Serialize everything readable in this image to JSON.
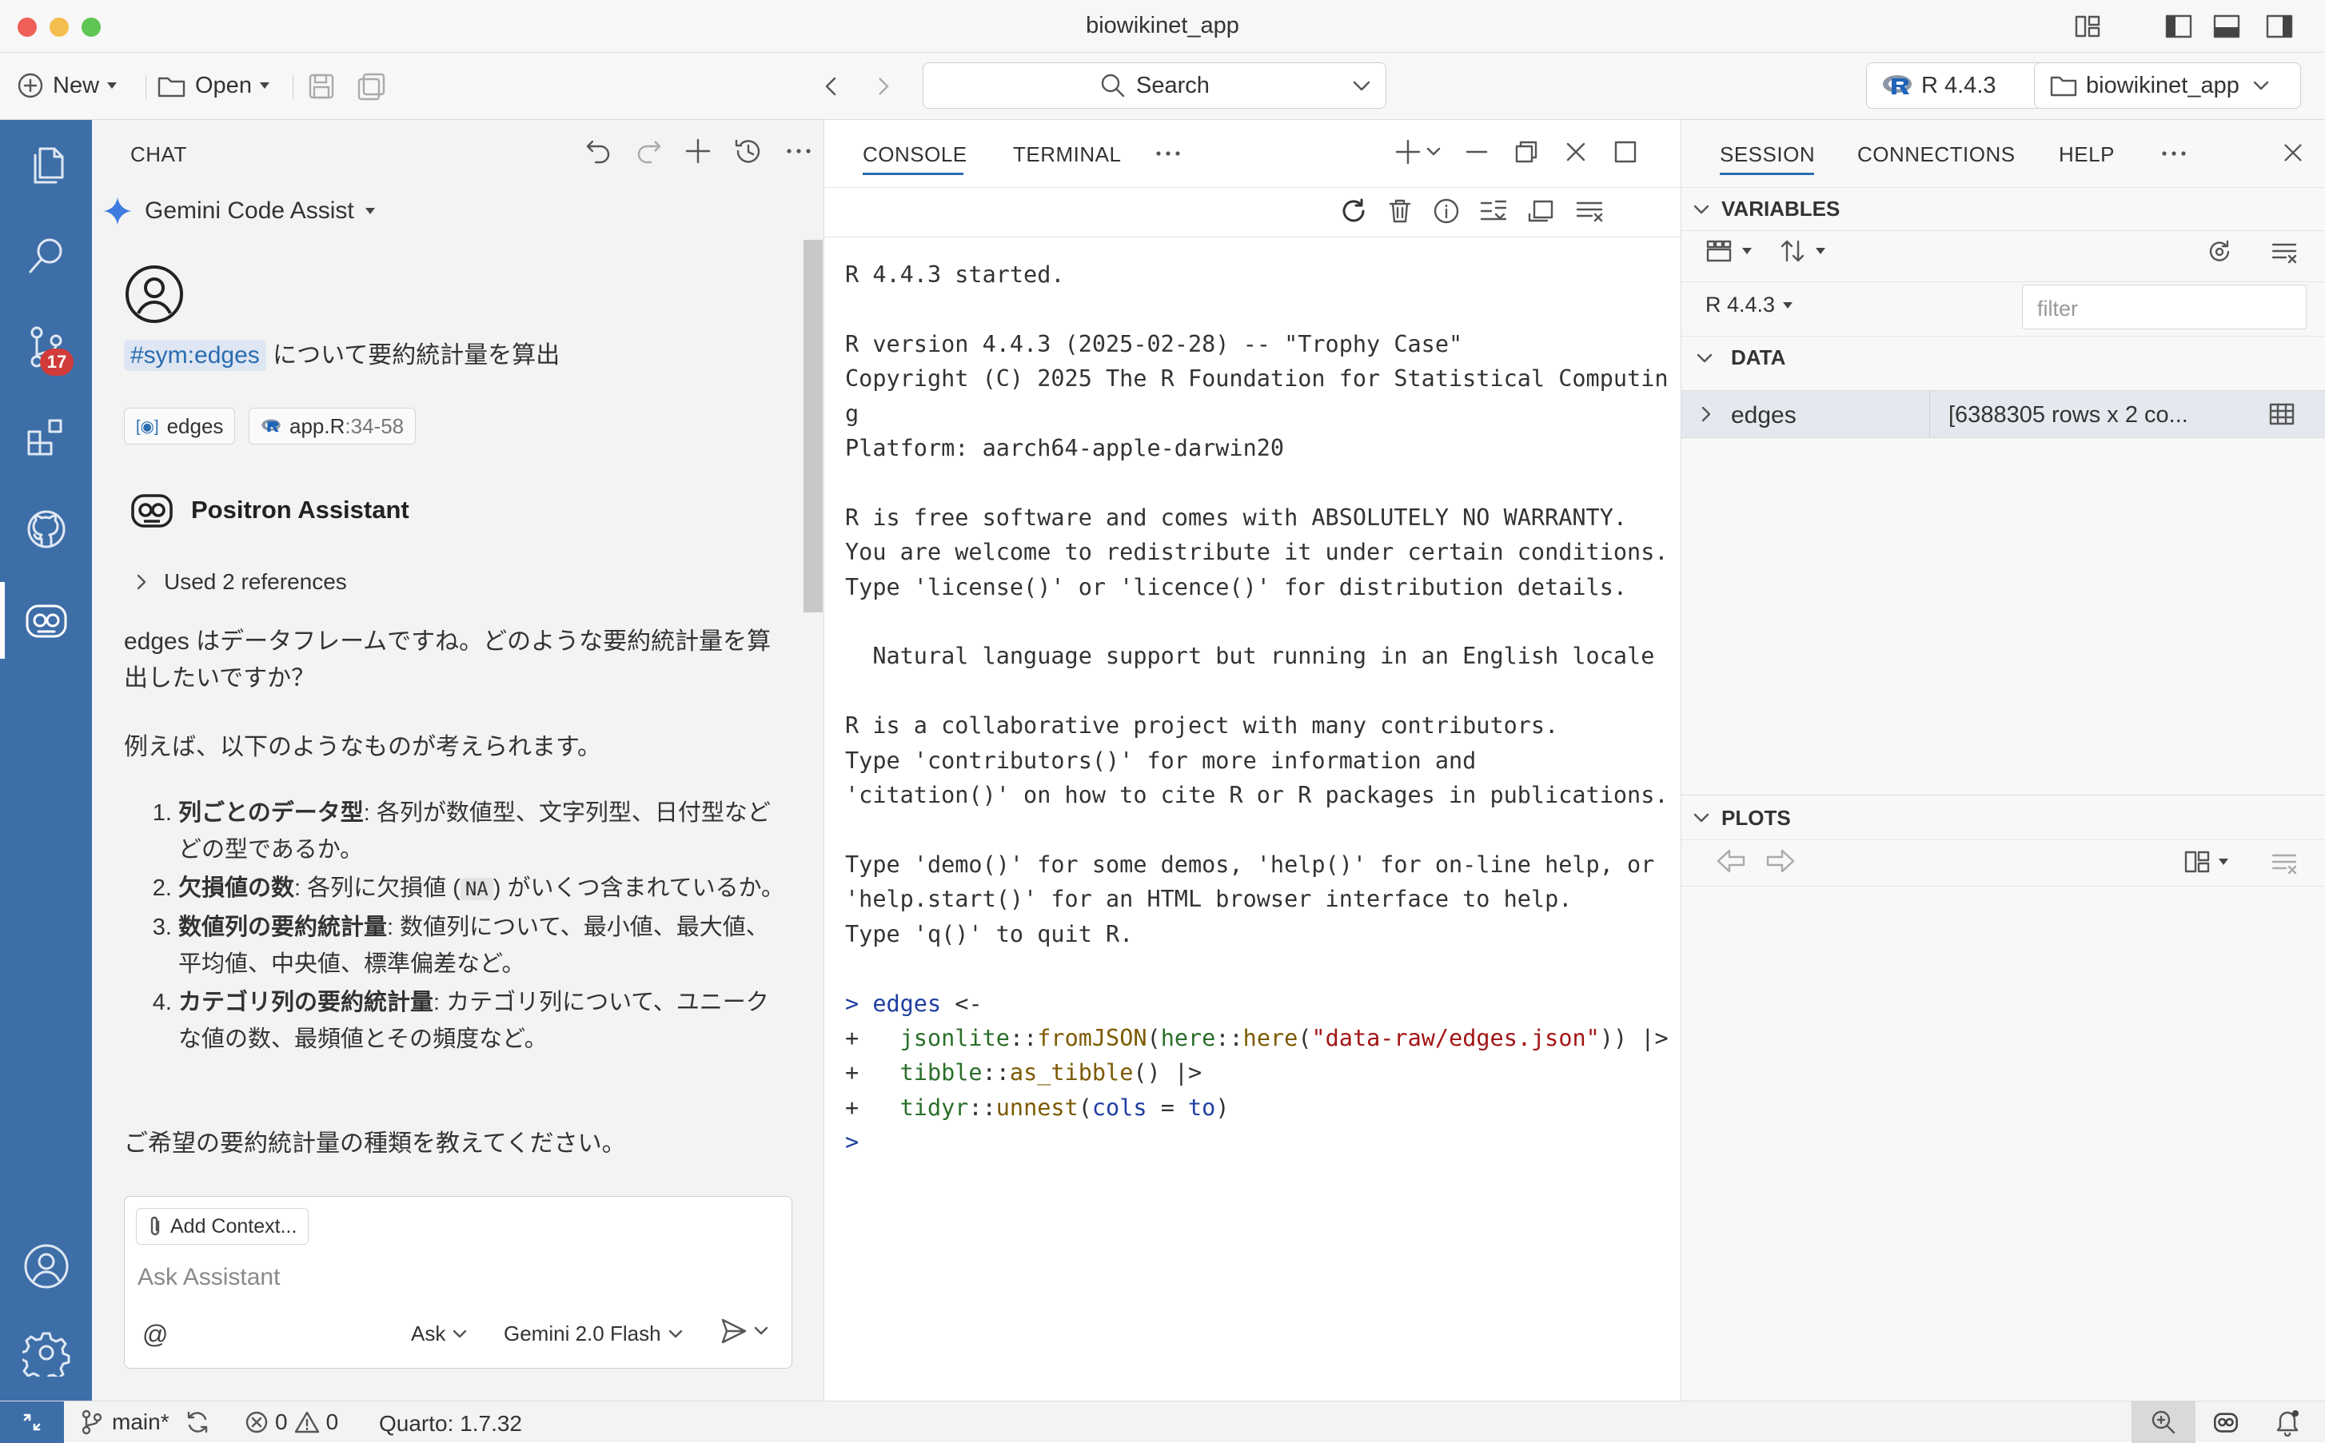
{
  "window": {
    "title": "biowikinet_app"
  },
  "toolbar": {
    "new_label": "New",
    "open_label": "Open",
    "search_label": "Search",
    "r_version": "R 4.4.3",
    "project": "biowikinet_app"
  },
  "activity": {
    "source_control_badge": "17"
  },
  "chat": {
    "title": "CHAT",
    "provider": "Gemini Code Assist",
    "user_tag": "#sym:edges",
    "user_text": "について要約統計量を算出",
    "refs": [
      {
        "label": "edges"
      },
      {
        "label": "app.R",
        "range": ":34-58"
      }
    ],
    "assistant_name": "Positron Assistant",
    "used_refs": "Used 2 references",
    "intro": "edges はデータフレームですね。どのような要約統計量を算出したいですか？",
    "examples_lead": "例えば、以下のようなものが考えられます。",
    "items": [
      {
        "bold": "列ごとのデータ型",
        "text": ": 各列が数値型、文字列型、日付型などどの型であるか。"
      },
      {
        "bold": "欠損値の数",
        "text_before": ": 各列に欠損値 (",
        "code": "NA",
        "text_after": ") がいくつ含まれているか。"
      },
      {
        "bold": "数値列の要約統計量",
        "text": ": 数値列について、最小値、最大値、平均値、中央値、標準偏差など。"
      },
      {
        "bold": "カテゴリ列の要約統計量",
        "text": ": カテゴリ列について、ユニークな値の数、最頻値とその頻度など。"
      }
    ],
    "closing": "ご希望の要約統計量の種類を教えてください。",
    "input": {
      "add_context": "Add Context...",
      "placeholder": "Ask Assistant",
      "mention": "@",
      "mode": "Ask",
      "model": "Gemini 2.0 Flash"
    }
  },
  "console": {
    "tabs": [
      "CONSOLE",
      "TERMINAL"
    ],
    "startup": [
      "R 4.4.3 started.",
      "",
      "R version 4.4.3 (2025-02-28) -- \"Trophy Case\"",
      "Copyright (C) 2025 The R Foundation for Statistical Computin",
      "g",
      "Platform: aarch64-apple-darwin20",
      "",
      "R is free software and comes with ABSOLUTELY NO WARRANTY.",
      "You are welcome to redistribute it under certain conditions.",
      "Type 'license()' or 'licence()' for distribution details.",
      "",
      "  Natural language support but running in an English locale",
      "",
      "R is a collaborative project with many contributors.",
      "Type 'contributors()' for more information and",
      "'citation()' on how to cite R or R packages in publications.",
      "",
      "Type 'demo()' for some demos, 'help()' for on-line help, or",
      "'help.start()' for an HTML browser interface to help.",
      "Type 'q()' to quit R.",
      ""
    ]
  },
  "session": {
    "tabs": [
      "SESSION",
      "CONNECTIONS",
      "HELP"
    ],
    "variables_label": "VARIABLES",
    "r_version": "R 4.4.3",
    "filter_placeholder": "filter",
    "data_label": "DATA",
    "variable_name": "edges",
    "variable_value": "[6388305 rows x 2 co...",
    "plots_label": "PLOTS"
  },
  "status": {
    "branch": "main*",
    "errors": "0",
    "warnings": "0",
    "quarto": "Quarto: 1.7.32"
  },
  "colors": {
    "activity_bar": "#3e6ea8",
    "badge": "#d13b3b",
    "accent": "#2b6cb0"
  }
}
